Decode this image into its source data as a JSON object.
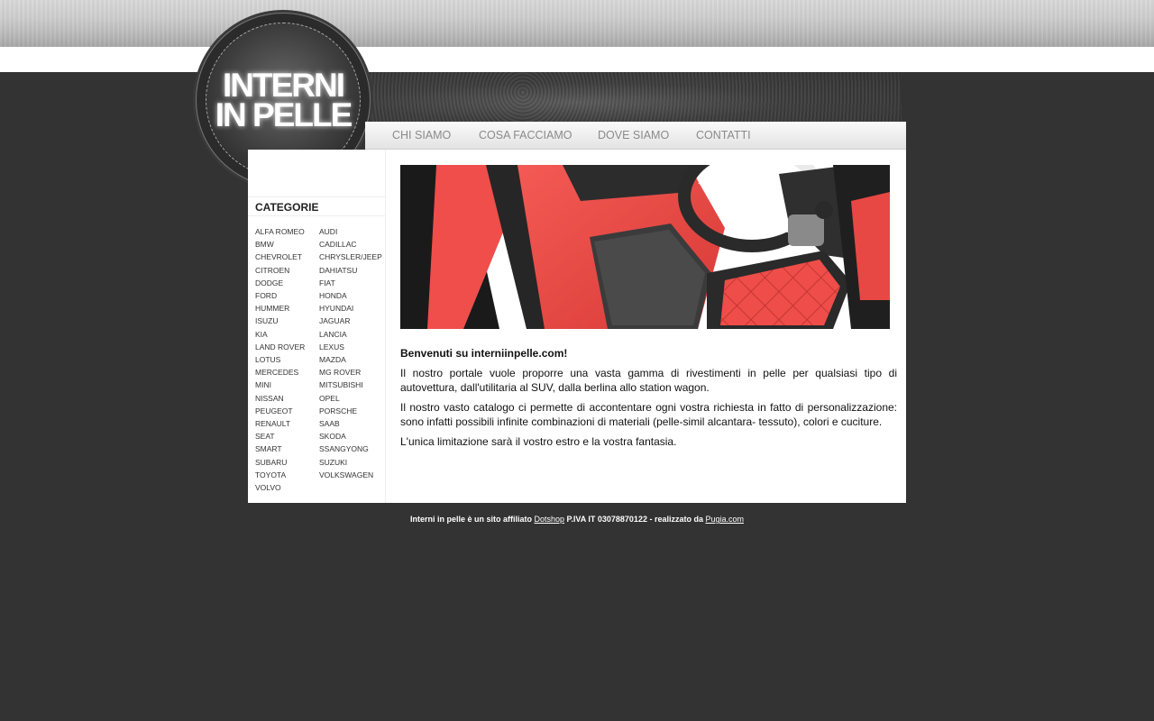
{
  "logo": {
    "line1": "INTERNI",
    "line2": "IN PELLE"
  },
  "nav": [
    "CHI SIAMO",
    "COSA FACCIAMO",
    "DOVE SIAMO",
    "CONTATTI"
  ],
  "sidebar": {
    "title": "CATEGORIE",
    "col1": [
      "ALFA ROMEO",
      "BMW",
      "CHEVROLET",
      "CITROEN",
      "DODGE",
      "FORD",
      "HUMMER",
      "ISUZU",
      "KIA",
      "LAND ROVER",
      "LOTUS",
      "MERCEDES",
      "MINI",
      "NISSAN",
      "PEUGEOT",
      "RENAULT",
      "SEAT",
      "SMART",
      "SUBARU",
      "TOYOTA",
      "VOLVO"
    ],
    "col2": [
      "AUDI",
      "CADILLAC",
      "CHRYSLER/JEEP",
      "DAHIATSU",
      "FIAT",
      "HONDA",
      "HYUNDAI",
      "JAGUAR",
      "LANCIA",
      "LEXUS",
      "MAZDA",
      "MG ROVER",
      "MITSUBISHI",
      "OPEL",
      "PORSCHE",
      "SAAB",
      "SKODA",
      "SSANGYONG",
      "SUZUKI",
      "VOLKSWAGEN"
    ]
  },
  "main": {
    "heading": "Benvenuti su interniinpelle.com!",
    "p1": "Il nostro portale vuole proporre una vasta gamma di rivestimenti in pelle per qualsiasi tipo di autovettura, dall'utilitaria al SUV, dalla berlina allo station wagon.",
    "p2": "Il nostro vasto catalogo ci permette di accontentare ogni vostra richiesta in fatto di personalizzazione: sono infatti possibili infinite combinazioni di materiali (pelle-simil alcantara- tessuto), colori e cuciture.",
    "p3": "L'unica limitazione sarà il vostro estro e la vostra fantasia."
  },
  "footer": {
    "text1": "Interni in pelle è un sito affiliato ",
    "link1": "Dotshop",
    "text2": " P.IVA IT 03078870122 - realizzato da ",
    "link2": "Pugia.com"
  },
  "colors": {
    "background": "#333333",
    "accent": "#e8423f"
  }
}
